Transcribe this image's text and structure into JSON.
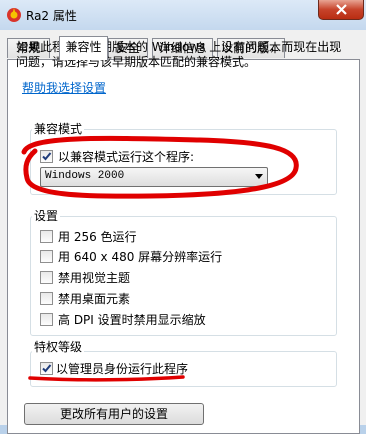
{
  "window": {
    "title": "Ra2 属性"
  },
  "tabs": [
    {
      "label": "常规"
    },
    {
      "label": "兼容性"
    },
    {
      "label": "安全"
    },
    {
      "label": "详细信息"
    },
    {
      "label": "以前的版本"
    }
  ],
  "description": "如果此程序在早期版本的 Windows 上没有问题，而现在出现问题，请选择与该早期版本匹配的兼容模式。",
  "help_link": "帮助我选择设置",
  "compat_mode": {
    "label": "兼容模式",
    "checkbox_label": "以兼容模式运行这个程序:",
    "checked": true,
    "selected_os": "Windows 2000"
  },
  "settings": {
    "label": "设置",
    "items": [
      {
        "label": "用 256 色运行",
        "checked": false
      },
      {
        "label": "用 640 x 480 屏幕分辨率运行",
        "checked": false
      },
      {
        "label": "禁用视觉主题",
        "checked": false
      },
      {
        "label": "禁用桌面元素",
        "checked": false
      },
      {
        "label": "高 DPI 设置时禁用显示缩放",
        "checked": false
      }
    ]
  },
  "privilege": {
    "label": "特权等级",
    "checkbox_label": "以管理员身份运行此程序",
    "checked": true
  },
  "all_users_button": "更改所有用户的设置",
  "colors": {
    "annotation": "#e00000",
    "link": "#0066cc"
  }
}
